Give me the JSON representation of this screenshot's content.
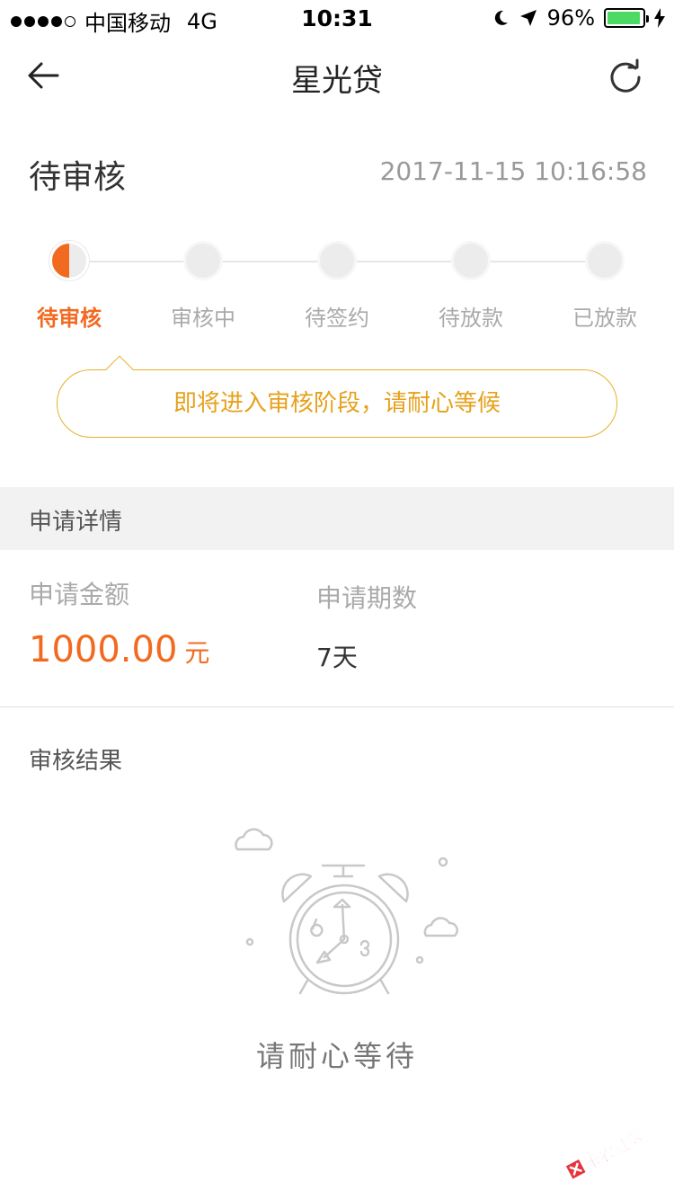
{
  "status_bar": {
    "carrier": "中国移动",
    "network": "4G",
    "time": "10:31",
    "battery": "96%",
    "battery_level": 0.96
  },
  "nav": {
    "title": "星光贷",
    "back_icon": "arrow-left-icon",
    "refresh_icon": "refresh-icon"
  },
  "order": {
    "status": "待审核",
    "timestamp": "2017-11-15 10:16:58"
  },
  "progress": {
    "steps": [
      "待审核",
      "审核中",
      "待签约",
      "待放款",
      "已放款"
    ],
    "current_index": 0
  },
  "notice": "即将进入审核阶段，请耐心等候",
  "details": {
    "section_title": "申请详情",
    "amount_label": "申请金额",
    "amount_value": "1000.00",
    "amount_unit": "元",
    "term_label": "申请期数",
    "term_value": "7天"
  },
  "result": {
    "title": "审核结果",
    "illustration_icon": "alarm-clock-icon",
    "wait_text": "请耐心等待"
  },
  "colors": {
    "accent": "#f26a20",
    "notice": "#e6a11d",
    "battery": "#4cd964"
  },
  "watermark": "卡农社区"
}
